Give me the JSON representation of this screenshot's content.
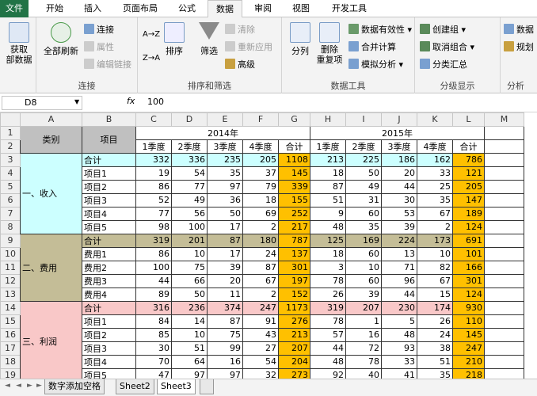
{
  "tabs": [
    "文件",
    "开始",
    "插入",
    "页面布局",
    "公式",
    "数据",
    "审阅",
    "视图",
    "开发工具"
  ],
  "ribbon": {
    "get_external": "获取\n部数据",
    "refresh_all": "全部刷新",
    "conn_items": [
      "连接",
      "属性",
      "编辑链接"
    ],
    "group_conn": "连接",
    "sort_az": "A→Z",
    "sort_za": "Z→A",
    "sort": "排序",
    "filter": "筛选",
    "filter_items": [
      "清除",
      "重新应用",
      "高级"
    ],
    "group_sort": "排序和筛选",
    "split": "分列",
    "remove_dup": "删除\n重复项",
    "tools_items": [
      "数据有效性",
      "合并计算",
      "模拟分析"
    ],
    "group_tools": "数据工具",
    "outline_items": [
      "创建组",
      "取消组合",
      "分类汇总"
    ],
    "group_outline": "分级显示",
    "right_items": [
      "数据",
      "规划"
    ],
    "group_right": "分析"
  },
  "formula_bar": {
    "name_box": "D8",
    "fx": "fx",
    "value": "100"
  },
  "columns": [
    "A",
    "B",
    "C",
    "D",
    "E",
    "F",
    "G",
    "H",
    "I",
    "J",
    "K",
    "L",
    "M"
  ],
  "header1": {
    "category": "类别",
    "item": "项目",
    "year1": "2014年",
    "year2": "2015年"
  },
  "header2": [
    "1季度",
    "2季度",
    "3季度",
    "4季度",
    "合计",
    "1季度",
    "2季度",
    "3季度",
    "4季度",
    "合计"
  ],
  "groups": [
    {
      "name": "一、收入",
      "rows": [
        [
          "合计",
          332,
          336,
          235,
          205,
          1108,
          213,
          225,
          186,
          162,
          786
        ],
        [
          "项目1",
          19,
          54,
          35,
          37,
          145,
          18,
          50,
          20,
          33,
          121
        ],
        [
          "项目2",
          86,
          77,
          97,
          79,
          339,
          87,
          49,
          44,
          25,
          205
        ],
        [
          "项目3",
          52,
          49,
          36,
          18,
          155,
          51,
          31,
          30,
          35,
          147
        ],
        [
          "项目4",
          77,
          56,
          50,
          69,
          252,
          9,
          60,
          53,
          67,
          189
        ],
        [
          "项目5",
          98,
          100,
          17,
          2,
          217,
          48,
          35,
          39,
          2,
          124
        ]
      ]
    },
    {
      "name": "二、费用",
      "rows": [
        [
          "合计",
          319,
          201,
          87,
          180,
          787,
          125,
          169,
          224,
          173,
          691
        ],
        [
          "费用1",
          86,
          10,
          17,
          24,
          137,
          18,
          60,
          13,
          10,
          101
        ],
        [
          "费用2",
          100,
          75,
          39,
          87,
          301,
          3,
          10,
          71,
          82,
          166
        ],
        [
          "费用3",
          44,
          66,
          20,
          67,
          197,
          78,
          60,
          96,
          67,
          301
        ],
        [
          "费用4",
          89,
          50,
          11,
          2,
          152,
          26,
          39,
          44,
          15,
          124
        ]
      ]
    },
    {
      "name": "三、利润",
      "rows": [
        [
          "合计",
          316,
          236,
          374,
          247,
          1173,
          319,
          207,
          230,
          174,
          930
        ],
        [
          "项目1",
          84,
          14,
          87,
          91,
          276,
          78,
          1,
          5,
          26,
          110
        ],
        [
          "项目2",
          85,
          10,
          75,
          43,
          213,
          57,
          16,
          48,
          24,
          145
        ],
        [
          "项目3",
          30,
          51,
          99,
          27,
          207,
          44,
          72,
          93,
          38,
          247
        ],
        [
          "项目4",
          70,
          64,
          16,
          54,
          204,
          48,
          78,
          33,
          51,
          210
        ],
        [
          "项目5",
          47,
          97,
          97,
          32,
          273,
          92,
          40,
          41,
          35,
          218
        ]
      ]
    }
  ],
  "sheet_tabs": [
    "数字添加空格",
    "Sheet2",
    "Sheet3"
  ],
  "active_sheet": "Sheet3"
}
